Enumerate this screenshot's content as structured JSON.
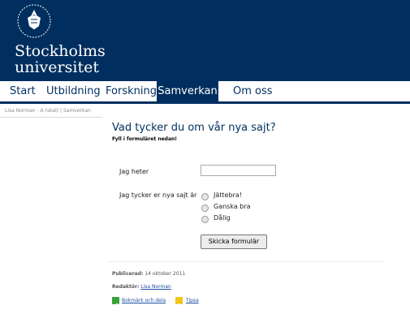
{
  "header": {
    "logo_line1": "Stockholms",
    "logo_line2": "universitet"
  },
  "nav": {
    "items": [
      "Start",
      "Utbildning",
      "Forskning",
      "Samverkan",
      "Om oss"
    ],
    "active": "Samverkan"
  },
  "breadcrumb": {
    "user": "Lisa Norman - A (skal)",
    "separator": "|",
    "section": "Samverkan"
  },
  "main": {
    "title": "Vad tycker du om vår nya sajt?",
    "subtitle": "Fyll i formuläret nedan!",
    "name_label": "Jag heter",
    "name_value": "",
    "opinion_label": "Jag tycker er nya sajt är",
    "options": [
      "Jättebra!",
      "Ganska bra",
      "Dålig"
    ],
    "submit_label": "Skicka formulär"
  },
  "footer": {
    "published_label": "Publicerad:",
    "published_date": "14 oktober 2011",
    "editor_label": "Redaktör:",
    "editor_name": "Lisa Norman",
    "share_label": "Bokmärk och dela",
    "tips_label": "Tipsa"
  },
  "colors": {
    "brand": "#002f5f",
    "link": "#1f4fa3"
  }
}
